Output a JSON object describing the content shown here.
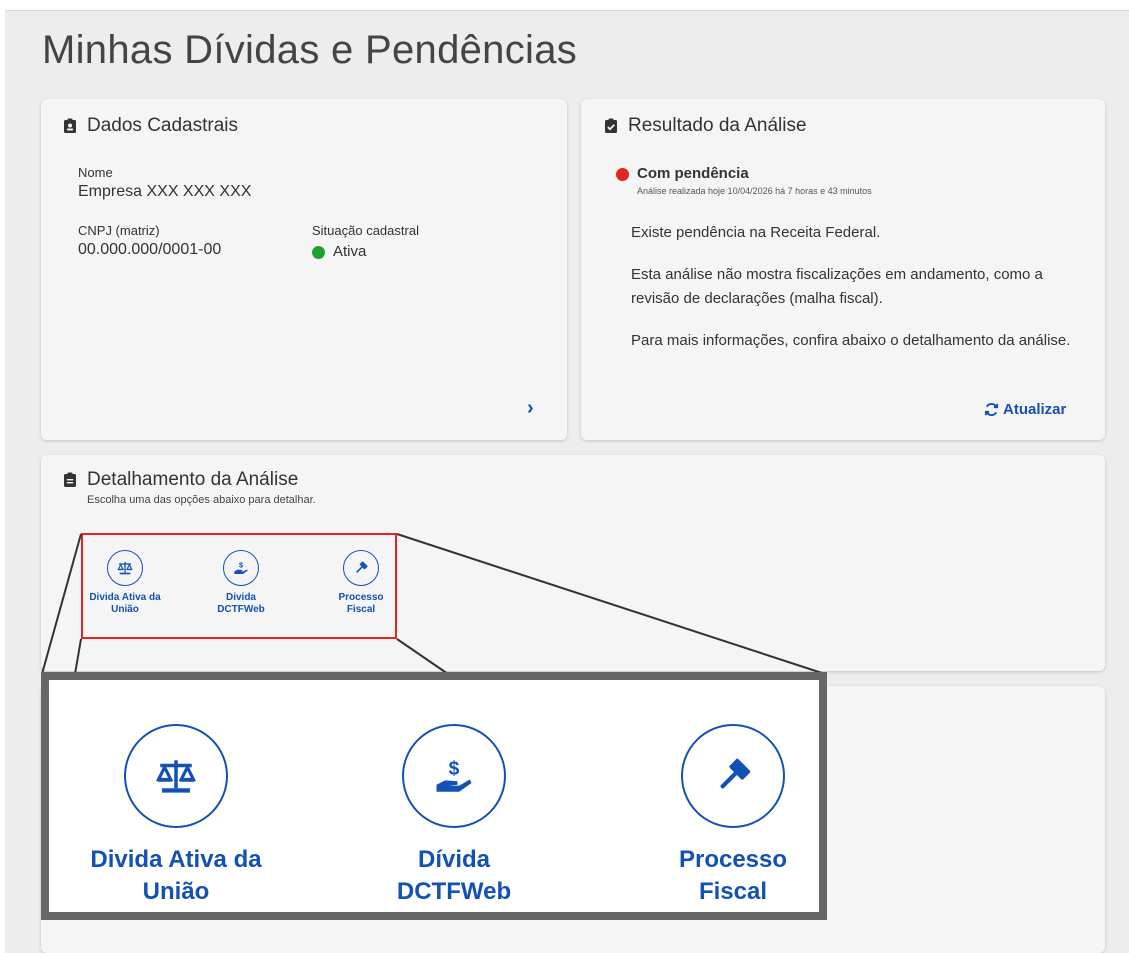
{
  "page": {
    "title": "Minhas Dívidas e Pendências"
  },
  "dados_cadastrais": {
    "title": "Dados Cadastrais",
    "nome_label": "Nome",
    "nome_value": "Empresa XXX XXX XXX",
    "cnpj_label": "CNPJ (matriz)",
    "cnpj_value": "00.000.000/0001-00",
    "situacao_label": "Situação cadastral",
    "situacao_value": "Ativa",
    "status_color": "#1fa22e"
  },
  "resultado": {
    "title": "Resultado da Análise",
    "status": "Com pendência",
    "status_color": "#e52521",
    "timestamp": "Análise realizada hoje 10/04/2026 há 7 horas e 43 minutos",
    "line1": "Existe pendência na Receita Federal.",
    "line2": "Esta análise não mostra fiscalizações em andamento, como a revisão de declarações (malha fiscal).",
    "line3": "Para mais informações, confira abaixo o detalhamento da análise.",
    "refresh_label": "Atualizar"
  },
  "detalhamento": {
    "title": "Detalhamento da Análise",
    "subtitle": "Escolha uma das opções abaixo para detalhar.",
    "options": [
      {
        "label": "Divida Ativa da\nUnião",
        "icon": "scale-icon"
      },
      {
        "label": "Divida\nDCTFWeb",
        "icon": "hand-money-icon"
      },
      {
        "label": "Processo\nFiscal",
        "icon": "gavel-icon"
      }
    ]
  },
  "zoom": {
    "options": [
      {
        "label": "Divida Ativa da\nUnião",
        "icon": "scale-icon"
      },
      {
        "label": "Dívida\nDCTFWeb",
        "icon": "hand-money-icon"
      },
      {
        "label": "Processo\nFiscal",
        "icon": "gavel-icon"
      }
    ]
  },
  "colors": {
    "accent": "#1351b4",
    "highlight": "#e52521"
  }
}
